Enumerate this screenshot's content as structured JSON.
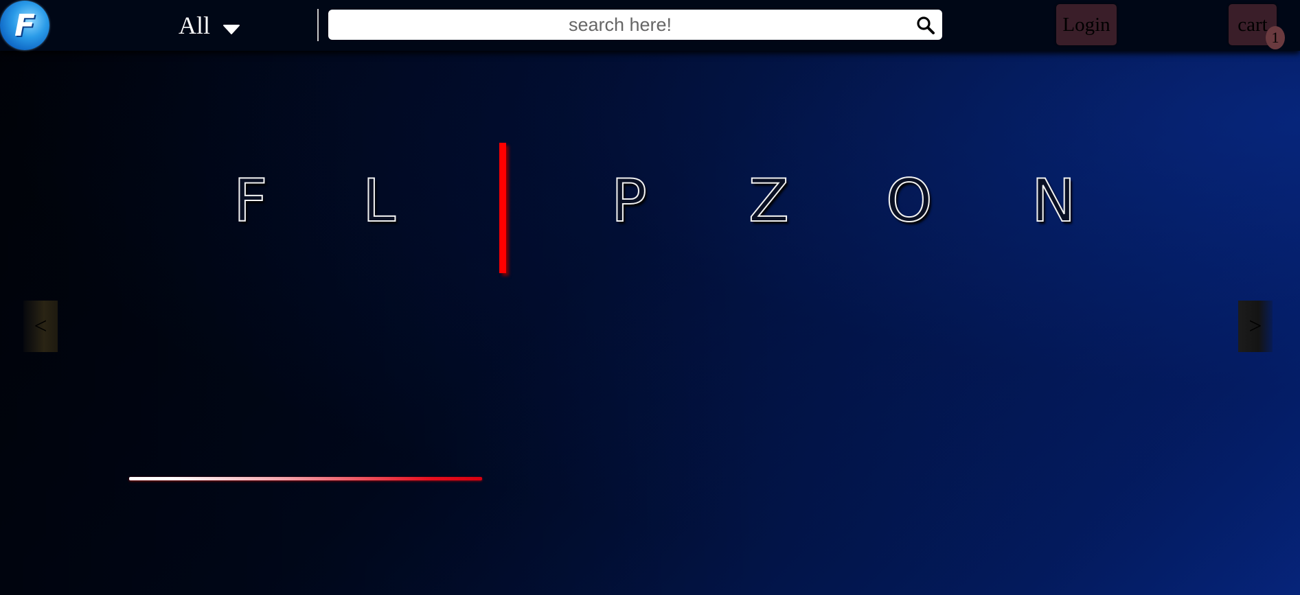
{
  "header": {
    "logo_letter": "F",
    "category_label": "All",
    "search_placeholder": "search here!",
    "search_value": "",
    "login_label": "Login",
    "cart_label": "cart",
    "cart_count": "1"
  },
  "hero": {
    "letters": [
      "F",
      "L",
      "P",
      "Z",
      "O",
      "N"
    ],
    "cursor_color": "#ff0000"
  },
  "carousel": {
    "prev_label": "<",
    "next_label": ">",
    "progress_fraction": 0.34
  },
  "colors": {
    "topbar": "#000716",
    "accent_red": "#ff0000",
    "button_bg": "#3a1e29",
    "logo_blue": "#2a9be8"
  },
  "icons": [
    "logo-icon",
    "chevron-down-icon",
    "search-icon"
  ]
}
